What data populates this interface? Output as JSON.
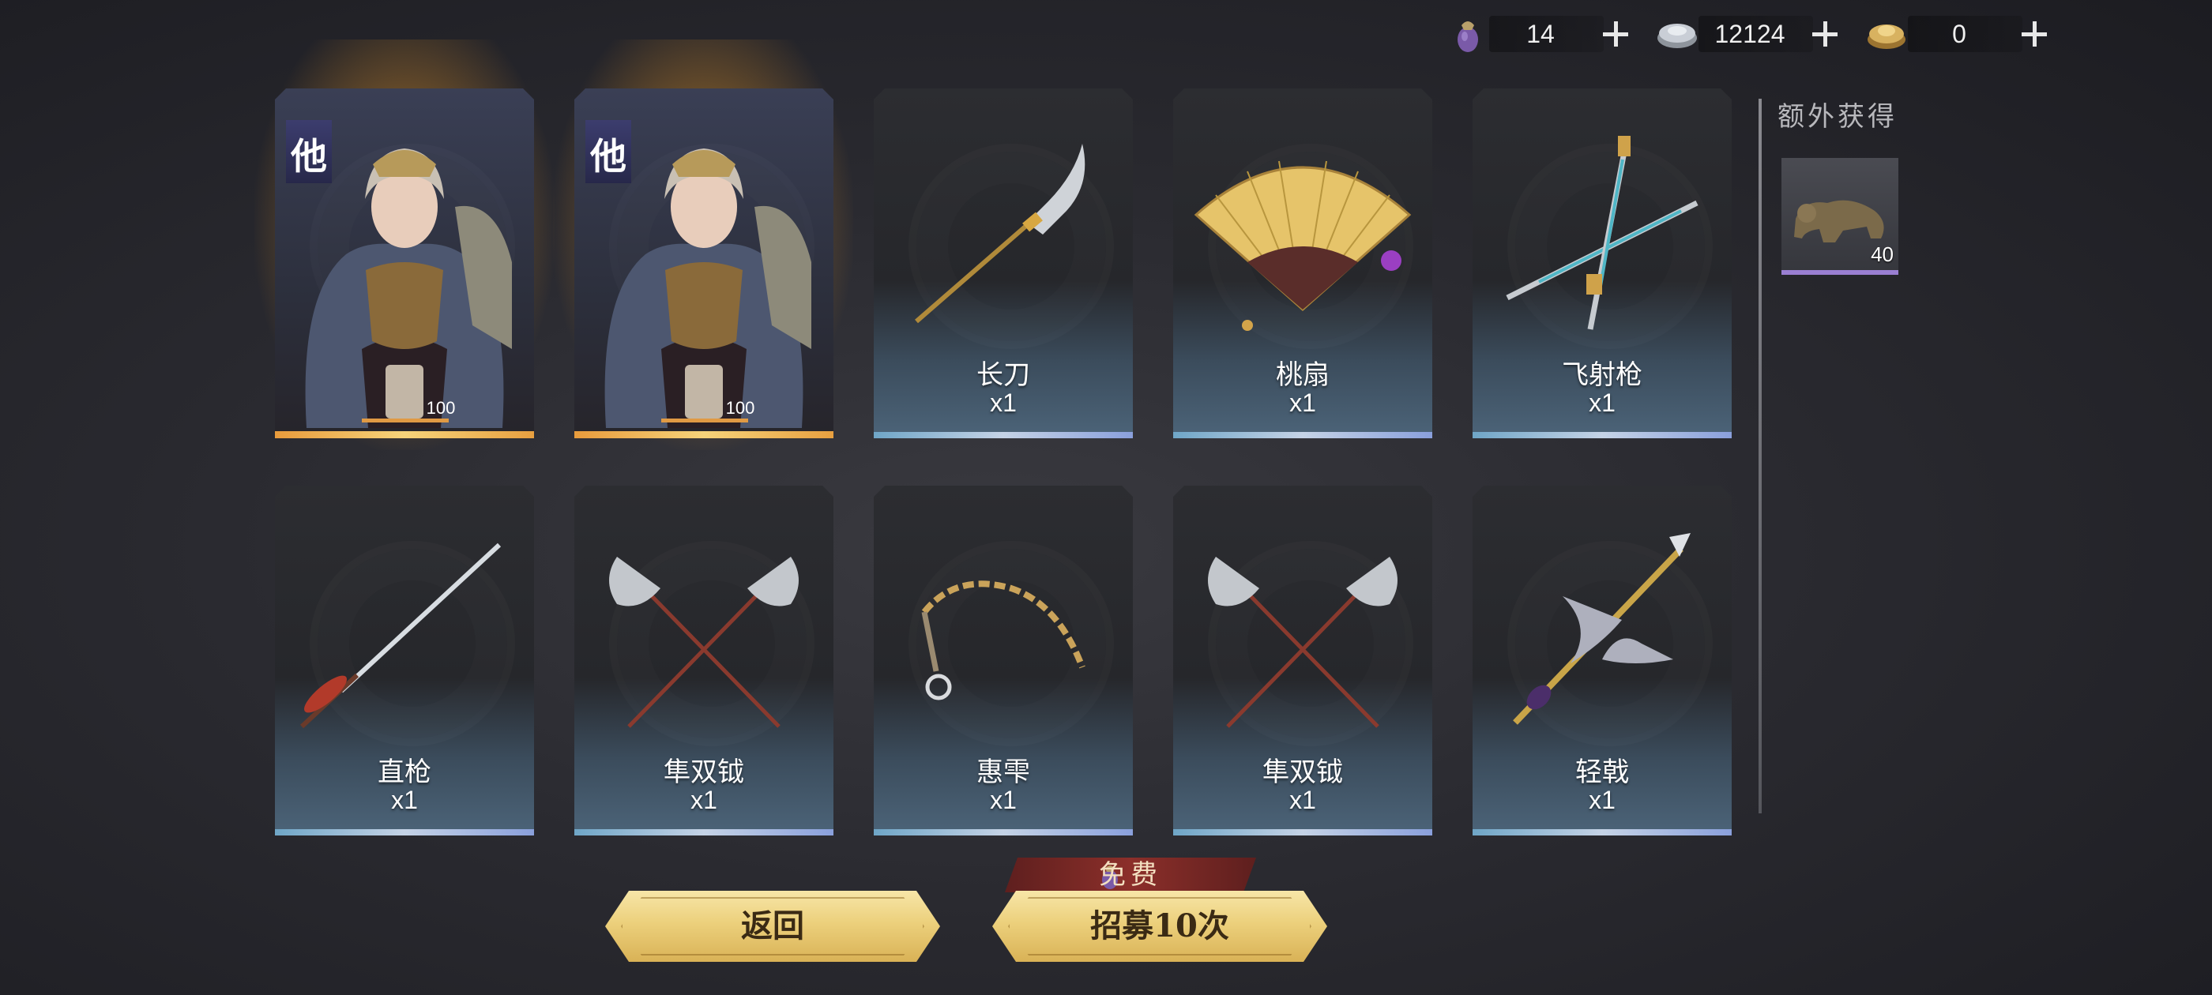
{
  "currencies": [
    {
      "name": "potion-currency",
      "icon": "purple-pouch-icon",
      "value": "14"
    },
    {
      "name": "silver-currency",
      "icon": "silver-ingot-icon",
      "value": "12124"
    },
    {
      "name": "gold-currency",
      "icon": "gold-ingot-icon",
      "value": "0"
    }
  ],
  "hero_cards": [
    {
      "badge": "他",
      "level": "100"
    },
    {
      "badge": "他",
      "level": "100"
    }
  ],
  "weapon_cards": [
    {
      "name": "长刀",
      "qty": "x1",
      "icon": "glaive-icon"
    },
    {
      "name": "桃扇",
      "qty": "x1",
      "icon": "folding-fan-icon"
    },
    {
      "name": "飞射枪",
      "qty": "x1",
      "icon": "crossed-spears-icon"
    },
    {
      "name": "直枪",
      "qty": "x1",
      "icon": "spear-icon"
    },
    {
      "name": "隼双钺",
      "qty": "x1",
      "icon": "twin-axes-icon"
    },
    {
      "name": "惠雫",
      "qty": "x1",
      "icon": "whip-icon"
    },
    {
      "name": "隼双钺",
      "qty": "x1",
      "icon": "twin-axes-icon"
    },
    {
      "name": "轻戟",
      "qty": "x1",
      "icon": "halberd-icon"
    }
  ],
  "extra": {
    "title": "额外获得",
    "item": {
      "icon": "bronze-beast-icon",
      "count": "40"
    }
  },
  "buttons": {
    "back": "返回",
    "recruit": "招募10次",
    "free_tag": "免费"
  },
  "colors": {
    "gold_button": "#ecd07c",
    "card_stripe": "#8aa0dc",
    "hero_stripe": "#f6d37a",
    "free_tag": "#8c2f2a"
  }
}
